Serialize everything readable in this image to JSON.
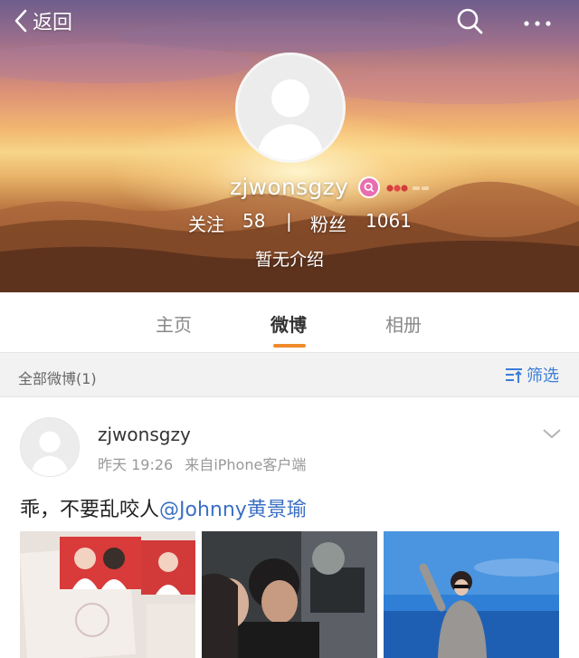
{
  "header": {
    "back_label": "返回",
    "back_icon": "chevron-left-icon",
    "search_icon": "search-icon",
    "more_icon": "more-dots-icon"
  },
  "profile": {
    "username": "zjwonsgzy",
    "following_label": "关注",
    "following_count": "58",
    "separator": "|",
    "followers_label": "粉丝",
    "followers_count": "1061",
    "bio": "暂无介绍",
    "badge_icon": "vip-badge-icon",
    "medal_icon": "medal-icon"
  },
  "tabs": [
    {
      "label": "主页",
      "active": false
    },
    {
      "label": "微博",
      "active": true
    },
    {
      "label": "相册",
      "active": false
    }
  ],
  "filter_bar": {
    "all_label": "全部微博(1)",
    "filter_label": "筛选",
    "filter_icon": "filter-icon"
  },
  "post": {
    "username": "zjwonsgzy",
    "time": "昨天 19:26",
    "source_prefix": "来自",
    "source_name": "iPhone客户端",
    "text_plain": "乖，不要乱咬人",
    "mention": "@Johnny黄景瑜",
    "more_icon": "chevron-down-icon",
    "photos": [
      "photo-1",
      "photo-2",
      "photo-3"
    ]
  },
  "colors": {
    "accent_orange": "#f08a2a",
    "link_blue": "#3b6fc4",
    "filter_blue": "#3b7dd8"
  }
}
